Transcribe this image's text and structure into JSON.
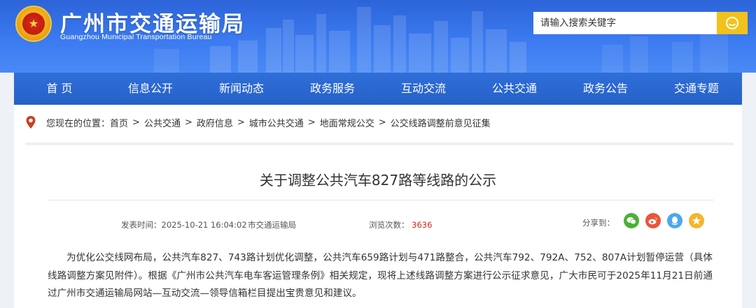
{
  "header": {
    "site_title": "广州市交通运输局",
    "site_subtitle": "Guangzhou Municipal Transportation Bureau",
    "search_placeholder": "请输入搜索关键字"
  },
  "nav": {
    "items": [
      "首 页",
      "信息公开",
      "新闻动态",
      "政务服务",
      "互动交流",
      "公共交通",
      "政务公告",
      "交通专题"
    ]
  },
  "breadcrumb": {
    "prefix": "您现在的位置：",
    "items": [
      "首页",
      "公共交通",
      "政府信息",
      "城市公共交通",
      "地面常规公交",
      "公交线路调整前意见征集"
    ],
    "separator": ">"
  },
  "article": {
    "title": "关于调整公共汽车827路等线路的公示",
    "publish_time": "发表时间：2025-10-21 16:04:02",
    "source": "市交通运输局",
    "views_label": "浏览次数：",
    "views_count": "3636",
    "share_label": "分享到：",
    "body": "为优化公交线网布局，公共汽车827、743路计划优化调整，公共汽车659路计划与471路整合，公共汽车792、792A、752、807A计划暂停运营（具体线路调整方案见附件）。根据《广州市公共汽车电车客运管理条例》相关规定，现将上述线路调整方案进行公示征求意见，广大市民可于2025年11月21日前通过广州市交通运输局网站—互动交流—领导信箱栏目提出宝贵意见和建议。"
  },
  "colors": {
    "header_blue": "#3b7af0",
    "nav_blue": "#2660c8",
    "search_button": "#f2c21a",
    "views_red": "#d8261b",
    "wechat_green": "#49b233",
    "weibo_orange": "#e8553c",
    "qq_blue": "#4ca8ea",
    "qzone_yellow": "#f5b52a"
  },
  "icons": {
    "search": "search-icon",
    "location": "location-pin-icon",
    "share": [
      "wechat-icon",
      "weibo-icon",
      "qq-icon",
      "qzone-icon"
    ]
  }
}
